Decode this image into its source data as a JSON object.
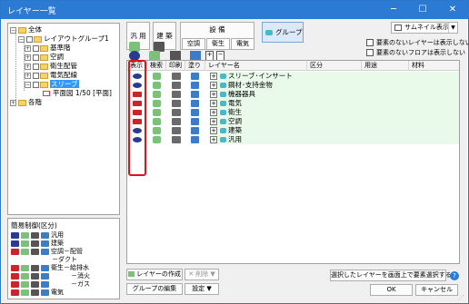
{
  "window": {
    "title": "レイヤー一覧",
    "min": "─",
    "max": "☐",
    "close": "✕"
  },
  "tree": {
    "root": "全体",
    "group": "レイアウトグループ1",
    "items": [
      "基準階",
      "空調",
      "衛生配管",
      "電気配線",
      "スリーブ"
    ],
    "child": "平面図 1/50 [平面]",
    "other": "各階"
  },
  "simple": {
    "title": "簡易制御(区分)",
    "rows": [
      "汎用",
      "建築",
      "空調－配管",
      "－ダクト",
      "衛生－給排水",
      "－消火",
      "－ガス",
      "電気"
    ]
  },
  "categories": {
    "general": "汎 用",
    "building": "建 築",
    "equipment": "設 備",
    "hvac": "空調",
    "sanitary": "衛生",
    "electric": "電気",
    "group": "グループ"
  },
  "options": {
    "thumbnail": "サムネイル表示",
    "hide_unneeded_layers": "要素のないレイヤーは表示しない",
    "hide_unneeded_floors": "要素のないフロアは表示しない"
  },
  "table": {
    "headers": [
      "表示",
      "検索",
      "印刷",
      "塗り",
      "レイヤー名",
      "区分",
      "用途",
      "材料"
    ],
    "rows": [
      {
        "name": "スリーブ･インサート",
        "eye": "blue"
      },
      {
        "name": "鋼材･支持金物",
        "eye": "blue"
      },
      {
        "name": "機器器具",
        "eye": "red"
      },
      {
        "name": "電気",
        "eye": "red"
      },
      {
        "name": "衛生",
        "eye": "red"
      },
      {
        "name": "空調",
        "eye": "red"
      },
      {
        "name": "建築",
        "eye": "blue"
      },
      {
        "name": "汎用",
        "eye": "blue"
      }
    ]
  },
  "buttons": {
    "create_layer": "レイヤーの作成",
    "delete": "削除",
    "edit_group": "グループの編集",
    "settings": "設定",
    "select_on_screen": "選択したレイヤーを画面上で要素選択する",
    "ok": "OK",
    "cancel": "キャンセル",
    "help": "?"
  },
  "colors": {
    "accent": "#2b7bd5",
    "highlight": "#e0131b",
    "row_fill": "#eafaea"
  }
}
